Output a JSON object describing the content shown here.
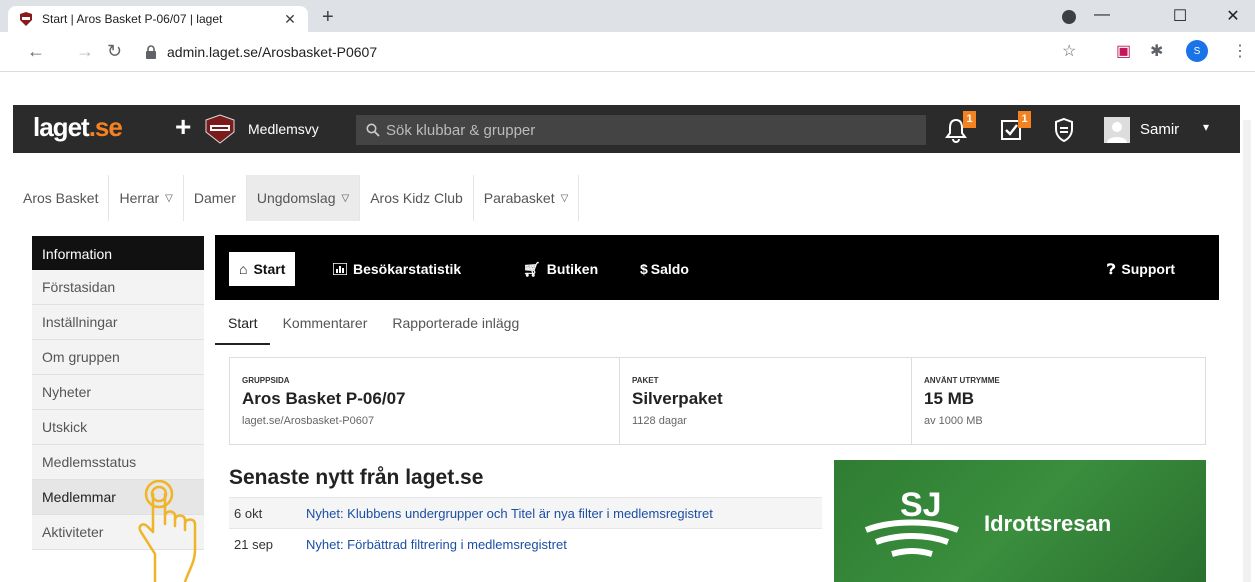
{
  "browser": {
    "tab_title": "Start | Aros Basket P-06/07 | laget",
    "new_tab_symbol": "+",
    "url": "admin.laget.se/Arosbasket-P0607",
    "profile_initial": "S"
  },
  "site_header": {
    "logo_main": "laget",
    "logo_suffix": ".se",
    "plus_symbol": "+",
    "member_view_label": "Medlemsvy",
    "search_placeholder": "Sök klubbar & grupper",
    "notifications_count": "1",
    "tasks_count": "1",
    "user_name": "Samir",
    "caret": "▾"
  },
  "top_nav": {
    "items": [
      {
        "label": "Aros Basket"
      },
      {
        "label": "Herrar"
      },
      {
        "label": "Damer"
      },
      {
        "label": "Ungdomslag"
      },
      {
        "label": "Aros Kidz Club"
      },
      {
        "label": "Parabasket"
      }
    ],
    "chevron": "⌄"
  },
  "sidebar": {
    "heading": "Information",
    "items": [
      {
        "label": "Förstasidan"
      },
      {
        "label": "Inställningar"
      },
      {
        "label": "Om gruppen"
      },
      {
        "label": "Nyheter"
      },
      {
        "label": "Utskick"
      },
      {
        "label": "Medlemsstatus"
      },
      {
        "label": "Medlemmar"
      },
      {
        "label": "Aktiviteter"
      }
    ]
  },
  "main_tabs": {
    "start": "Start",
    "stats": "Besökarstatistik",
    "shop": "Butiken",
    "balance": "Saldo",
    "support": "Support"
  },
  "sub_tabs": {
    "items": [
      {
        "label": "Start"
      },
      {
        "label": "Kommentarer"
      },
      {
        "label": "Rapporterade inlägg"
      }
    ]
  },
  "info": {
    "group": {
      "label": "Gruppsida",
      "value": "Aros Basket P-06/07",
      "sub": "laget.se/Arosbasket-P0607"
    },
    "package": {
      "label": "Paket",
      "value": "Silverpaket",
      "sub": "1128 dagar"
    },
    "storage": {
      "label": "Använt utrymme",
      "value": "15 MB",
      "sub": "av 1000 MB"
    }
  },
  "news": {
    "title": "Senaste nytt från laget.se",
    "items": [
      {
        "date": "6 okt",
        "text": "Nyhet: Klubbens undergrupper och Titel är nya filter i medlemsregistret"
      },
      {
        "date": "21 sep",
        "text": "Nyhet: Förbättrad filtrering i medlemsregistret"
      }
    ]
  },
  "ad": {
    "brand": "SJ",
    "text": "Idrottsresan"
  }
}
